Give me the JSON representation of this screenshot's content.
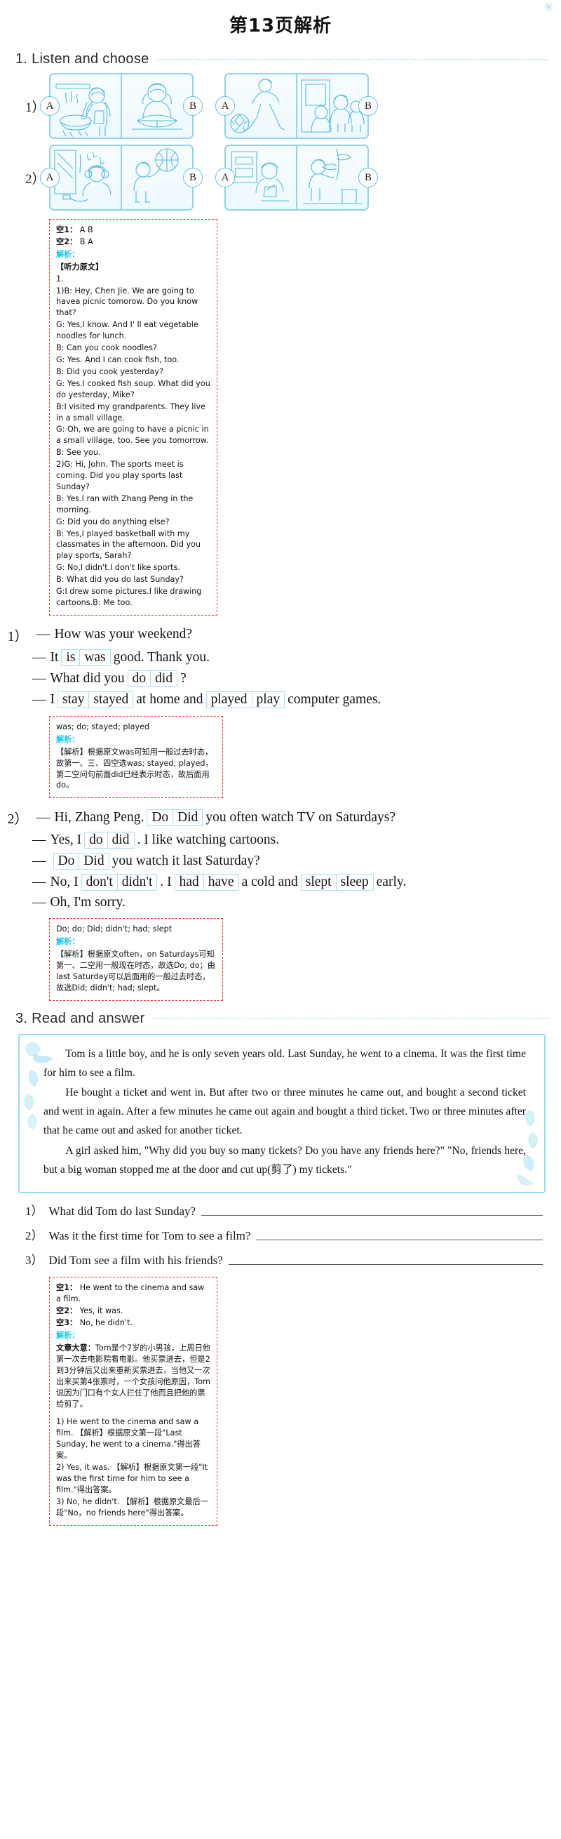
{
  "page": {
    "title": "第13页解析"
  },
  "section1": {
    "heading": "1. Listen and choose",
    "items": [
      {
        "number": "1）",
        "pairs": [
          {
            "left_badge": "A",
            "right_badge": "B",
            "left_scene": "girl-cooking-soup-icon",
            "right_scene": "girl-reading-book-icon"
          },
          {
            "left_badge": "A",
            "right_badge": "B",
            "left_scene": "boy-playing-football-icon",
            "right_scene": "kids-visiting-grandparents-icon"
          }
        ]
      },
      {
        "number": "2）",
        "pairs": [
          {
            "left_badge": "A",
            "right_badge": "B",
            "left_scene": "boy-listening-music-icon",
            "right_scene": "boy-playing-basketball-icon"
          },
          {
            "left_badge": "A",
            "right_badge": "B",
            "left_scene": "girl-drawing-picture-icon",
            "right_scene": "girl-watering-plant-icon"
          }
        ]
      }
    ],
    "answer_box": {
      "answers": [
        {
          "key": "空1：",
          "value": "A B"
        },
        {
          "key": "空2：",
          "value": "B A"
        }
      ],
      "jiexi_label": "解析：",
      "script_title": "【听力原文】",
      "script_lines": [
        "1.",
        "1)B: Hey, Chen Jie. We are going to havea picnic tomorow. Do you know that?",
        "G: Yes,I know. And I' ll eat vegetable noodles for lunch.",
        "B: Can you cook noodles?",
        "G: Yes. And I can cook fish, too.",
        "B: Did you cook yesterday?",
        "G: Yes.I cooked fish soup. What did you do yesterday, Mike?",
        "B:I visited my grandparents. They live in a small village.",
        "G: Oh, we are going to have a picnic in a small village, too. See you tomorrow.",
        "B: See you.",
        "2)G: Hi, John. The sports meet is coming. Did you play sports last Sunday?",
        "B: Yes.I ran with Zhang Peng in the morning.",
        "G: Did you do anything else?",
        "B: Yes,I played basketball with my classmates in the afternoon. Did you play sports, Sarah?",
        "G: No,I didn't.I don't like sports.",
        "B: What did you do last Sunday?",
        "G:I drew some pictures.I like drawing cartoons.B: Me too."
      ]
    }
  },
  "section2": {
    "q1": {
      "number": "1）",
      "lines": [
        {
          "dash": "—",
          "before": "How was your weekend?",
          "choices": [],
          "after": ""
        },
        {
          "dash": "—",
          "before": "It",
          "choices": [
            "is",
            "was"
          ],
          "after": "good. Thank you."
        },
        {
          "dash": "—",
          "before": "What did you",
          "choices": [
            "do",
            "did"
          ],
          "after": "?"
        },
        {
          "dash": "—",
          "before": "I",
          "choices": [
            "stay",
            "stayed"
          ],
          "mid": "at home and",
          "choices2": [
            "played",
            "play"
          ],
          "after": "computer games."
        }
      ],
      "answer_box": {
        "answers": "was; do; stayed; played",
        "jiexi_label": "解析：",
        "explanation": "【解析】根据原文was可知用一般过去时态，故第一、三、四空选was; stayed; played，第二空问句前面did已经表示时态，故后面用do。"
      }
    },
    "q2": {
      "number": "2）",
      "lines": [
        {
          "dash": "—",
          "before": "Hi, Zhang Peng.",
          "choices": [
            "Do",
            "Did"
          ],
          "after": "you often watch TV on Saturdays?"
        },
        {
          "dash": "—",
          "before": "Yes, I",
          "choices": [
            "do",
            "did"
          ],
          "after": ". I like watching cartoons."
        },
        {
          "dash": "—",
          "before": "",
          "choices": [
            "Do",
            "Did"
          ],
          "after": "you watch it last Saturday?"
        },
        {
          "dash": "—",
          "before": "No, I",
          "choices": [
            "don't",
            "didn't"
          ],
          "mid": ". I",
          "choices2": [
            "had",
            "have"
          ],
          "mid2": "a cold and",
          "choices3": [
            "slept",
            "sleep"
          ],
          "after": "early."
        },
        {
          "dash": "—",
          "before": "Oh, I'm sorry.",
          "choices": [],
          "after": ""
        }
      ],
      "answer_box": {
        "answers": "Do; do; Did; didn't; had; slept",
        "jiexi_label": "解析：",
        "explanation": "【解析】根据原文often，on Saturdays可知第一、二空用一般现在时态，故选Do; do；由last Saturday可以后面用的一般过去时态，故选Did; didn't; had; slept。"
      }
    }
  },
  "section3": {
    "heading": "3. Read and answer",
    "passage": [
      "Tom is a little boy, and he is only seven years old. Last Sunday, he went to a cinema. It was the first time for him to see a film.",
      "He bought a ticket and went in. But after two or three minutes he came out, and bought a second ticket and went in again. After a few minutes he came out again and bought a third ticket. Two or three minutes after that he came out and asked for another ticket.",
      "A girl asked him, \"Why did you buy so many tickets? Do you have any friends here?\" \"No, friends here, but a big woman stopped me at the door and cut up(剪了) my tickets.\""
    ],
    "questions": [
      {
        "number": "1）",
        "text": "What did Tom do last Sunday?"
      },
      {
        "number": "2）",
        "text": "Was it the first time for Tom to see a film?"
      },
      {
        "number": "3）",
        "text": "Did Tom see a film with his friends?"
      }
    ],
    "answer_box": {
      "answers": [
        {
          "key": "空1：",
          "value": "He went to the cinema and saw a film."
        },
        {
          "key": "空2：",
          "value": "Yes, it was."
        },
        {
          "key": "空3：",
          "value": "No, he didn't."
        }
      ],
      "jiexi_label": "解析：",
      "summary_label": "文章大意：",
      "summary_text": "Tom是个7岁的小男孩，上周日他第一次去电影院看电影。他买票进去，但是2到3分钟后又出来重新买票进去，当他又一次出来买第4张票时，一个女孩问他原因，Tom说因为门口有个女人拦住了他而且把他的票给剪了。",
      "details": [
        "1) He went to the cinema and saw a film. 【解析】根据原文第一段\"Last Sunday, he went to a cinema.\"得出答案。",
        "2) Yes, it was. 【解析】根据原文第一段\"It was the first time for him to see a film.\"得出答案。",
        "3) No, he didn't. 【解析】根据原文最后一段\"No，no friends here\"得出答案。"
      ]
    }
  }
}
